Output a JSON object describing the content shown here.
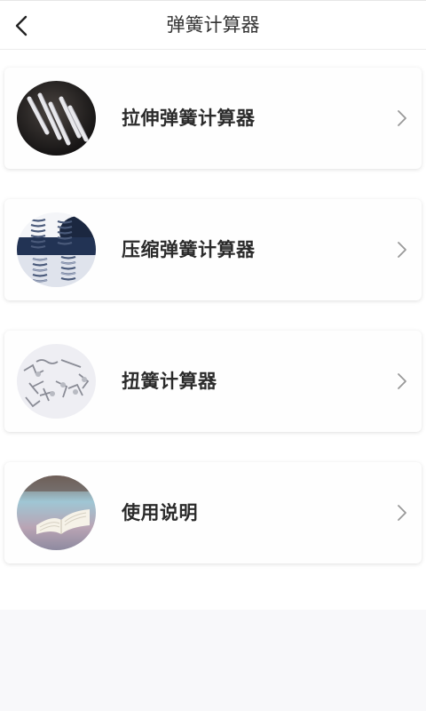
{
  "header": {
    "title": "弹簧计算器",
    "back_icon": "chevron-left-icon"
  },
  "menu": {
    "items": [
      {
        "label": "拉伸弹簧计算器",
        "image": "extension-springs-photo",
        "icon": "chevron-right-icon"
      },
      {
        "label": "压缩弹簧计算器",
        "image": "compression-springs-photo",
        "icon": "chevron-right-icon"
      },
      {
        "label": "扭簧计算器",
        "image": "torsion-springs-photo",
        "icon": "chevron-right-icon"
      },
      {
        "label": "使用说明",
        "image": "open-book-photo",
        "icon": "chevron-right-icon"
      }
    ]
  },
  "colors": {
    "header_background": "#ffffff",
    "page_background": "#f8f8fa",
    "card_background": "#fefefe",
    "title_text": "#333333",
    "label_text": "#2b2b2b",
    "chevron": "#999999"
  }
}
